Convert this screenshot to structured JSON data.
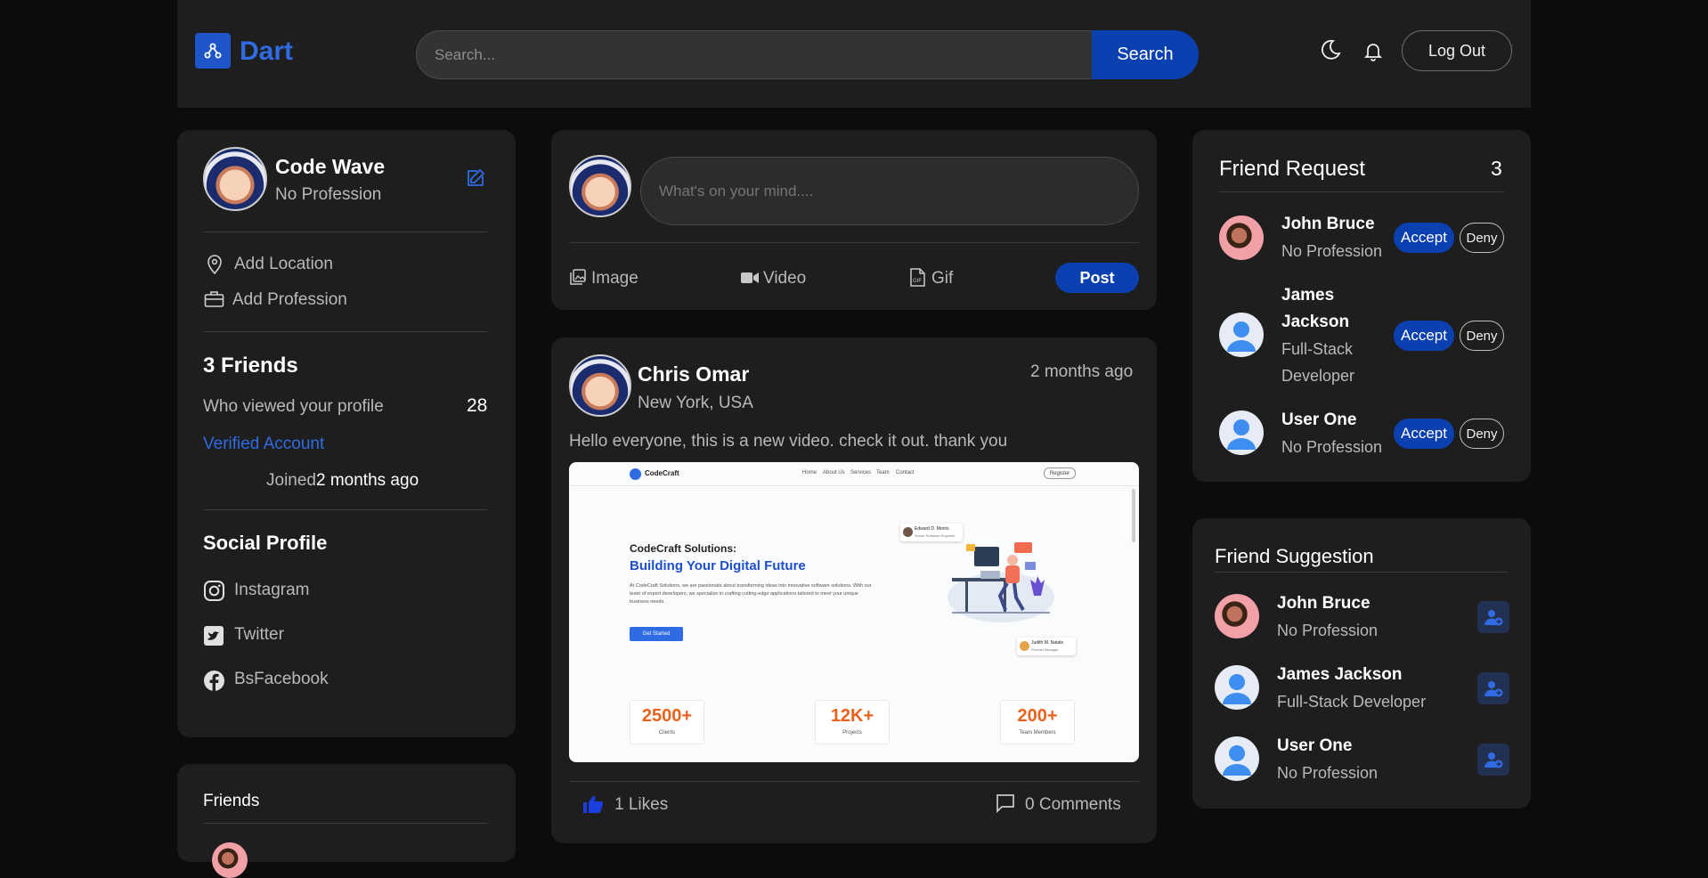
{
  "app": {
    "name": "Dart",
    "accent": "#1f55c8"
  },
  "header": {
    "search_placeholder": "Search...",
    "search_button": "Search",
    "theme_icon": "moon-icon",
    "notification_icon": "bell-icon",
    "logout_label": "Log Out"
  },
  "profile": {
    "name": "Code Wave",
    "profession": "No Profession",
    "add_location": "Add Location",
    "add_profession": "Add Profession",
    "friends_title": "3 Friends",
    "viewed_label": "Who viewed your profile",
    "viewed_count": "28",
    "verified": "Verified Account",
    "joined_label": "Joined",
    "joined_value": "2 months ago",
    "social_title": "Social Profile",
    "social": [
      "Instagram",
      "Twitter",
      "BsFacebook"
    ]
  },
  "friends_card": {
    "title": "Friends"
  },
  "composer": {
    "placeholder": "What's on your mind....",
    "image_label": "Image",
    "video_label": "Video",
    "gif_label": "Gif",
    "post_label": "Post"
  },
  "post": {
    "author": "Chris Omar",
    "location": "New York, USA",
    "time": "2 months ago",
    "text": "Hello everyone, this is a new video. check it out. thank you",
    "likes": "1 Likes",
    "comments": "0 Comments",
    "preview": {
      "brand": "CodeCraft",
      "nav": [
        "Home",
        "About Us",
        "Services",
        "Team",
        "Contact"
      ],
      "register": "Register",
      "subtitle": "CodeCraft Solutions:",
      "headline": "Building Your Digital Future",
      "body": "At CodeCraft Solutions, we are passionate about transforming ideas into innovative software solutions. With our team of expert developers, we specialize in crafting cutting-edge applications tailored to meet your unique business needs.",
      "cta": "Get Started",
      "person1": "Edward D. Morris",
      "person1_role": "Senior Software Engineer",
      "person2": "Judith M. Natale",
      "person2_role": "Product Manager",
      "stats": [
        {
          "value": "2500+",
          "label": "Clients"
        },
        {
          "value": "12K+",
          "label": "Projects"
        },
        {
          "value": "200+",
          "label": "Team Members"
        }
      ]
    }
  },
  "friend_requests": {
    "title": "Friend Request",
    "count": "3",
    "accept": "Accept",
    "deny": "Deny",
    "items": [
      {
        "name": "John Bruce",
        "profession": "No Profession"
      },
      {
        "name_line1": "James",
        "name_line2": "Jackson",
        "profession_line1": "Full-Stack",
        "profession_line2": "Developer"
      },
      {
        "name": "User One",
        "profession": "No Profession"
      }
    ]
  },
  "friend_suggestions": {
    "title": "Friend Suggestion",
    "items": [
      {
        "name": "John Bruce",
        "profession": "No Profession"
      },
      {
        "name": "James Jackson",
        "profession": "Full-Stack Developer"
      },
      {
        "name": "User One",
        "profession": "No Profession"
      }
    ]
  }
}
